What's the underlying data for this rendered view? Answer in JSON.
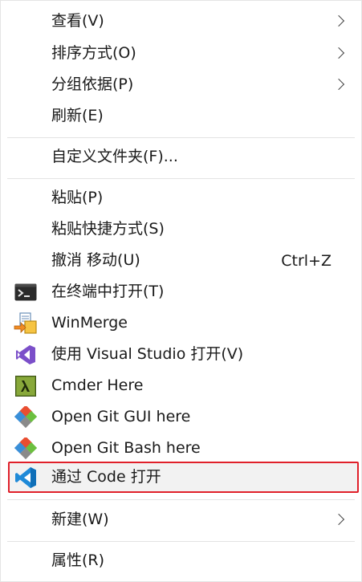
{
  "menu": {
    "items": [
      {
        "label": "查看(V)",
        "submenu": true
      },
      {
        "label": "排序方式(O)",
        "submenu": true
      },
      {
        "label": "分组依据(P)",
        "submenu": true
      },
      {
        "label": "刷新(E)"
      },
      {
        "label": "自定义文件夹(F)..."
      },
      {
        "label": "粘贴(P)"
      },
      {
        "label": "粘贴快捷方式(S)"
      },
      {
        "label": "撤消 移动(U)",
        "shortcut": "Ctrl+Z"
      },
      {
        "label": "在终端中打开(T)",
        "icon": "terminal-icon"
      },
      {
        "label": "WinMerge",
        "icon": "winmerge-icon"
      },
      {
        "label": "使用 Visual Studio 打开(V)",
        "icon": "visual-studio-icon"
      },
      {
        "label": "Cmder Here",
        "icon": "cmder-lambda-icon"
      },
      {
        "label": "Open Git GUI here",
        "icon": "git-icon"
      },
      {
        "label": "Open Git Bash here",
        "icon": "git-icon"
      },
      {
        "label": "通过 Code 打开",
        "icon": "vscode-icon",
        "highlighted": true
      },
      {
        "label": "新建(W)",
        "submenu": true
      },
      {
        "label": "属性(R)"
      }
    ]
  },
  "colors": {
    "highlight_border": "#e0202a",
    "highlight_fill": "#f2f2f2",
    "separator": "#e3e3e3",
    "text": "#1a1a1a"
  }
}
